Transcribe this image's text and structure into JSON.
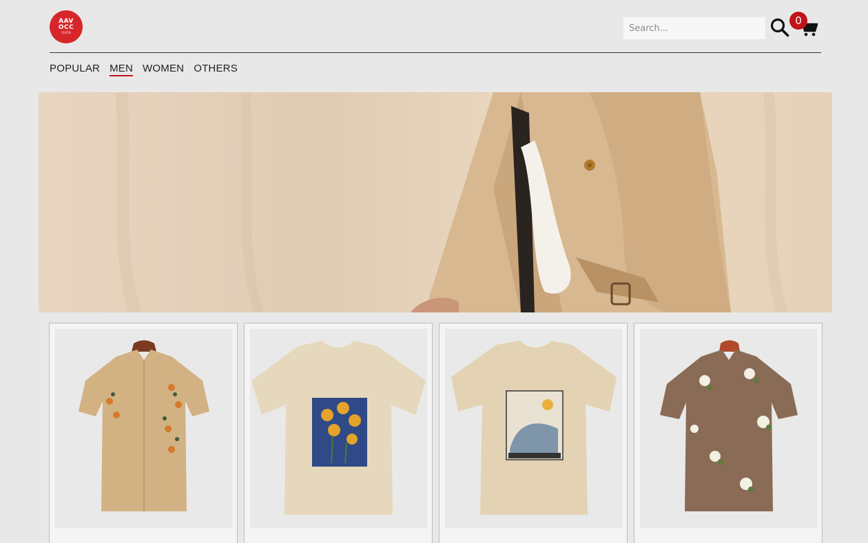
{
  "header": {
    "logo_lines": [
      "AAV",
      "OCC",
      "CLOTH"
    ],
    "search_placeholder": "Search...",
    "cart_count": "0"
  },
  "nav": {
    "items": [
      {
        "label": "POPULAR",
        "active": false
      },
      {
        "label": "MEN",
        "active": true
      },
      {
        "label": "WOMEN",
        "active": false
      },
      {
        "label": "OTHERS",
        "active": false
      }
    ]
  },
  "colors": {
    "accent": "#c1141a",
    "logo": "#d7262b"
  },
  "products": [
    {
      "icon": "embroidered-shirt-image"
    },
    {
      "icon": "sunflower-tshirt-image"
    },
    {
      "icon": "nature-print-tshirt-image"
    },
    {
      "icon": "floral-shirt-image"
    }
  ]
}
